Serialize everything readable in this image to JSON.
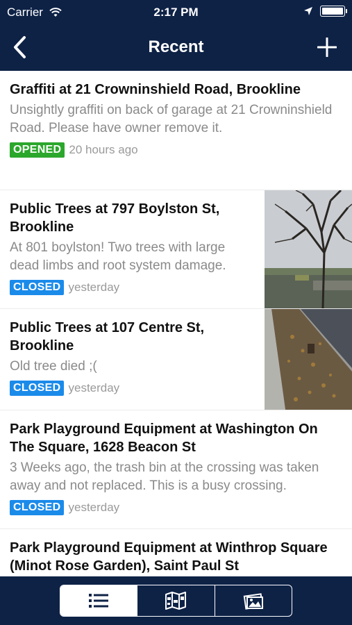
{
  "status_bar": {
    "carrier": "Carrier",
    "time": "2:17 PM"
  },
  "nav": {
    "title": "Recent",
    "back_icon": "chevron-left-icon",
    "add_icon": "plus-icon"
  },
  "items": [
    {
      "title": "Graffiti at 21 Crowninshield Road, Brookline",
      "description": "Unsightly graffiti on back of garage at 21 Crowninshield Road. Please have owner remove it.",
      "status": "OPENED",
      "time": "20 hours ago",
      "has_thumbnail": false
    },
    {
      "title": "Public Trees at 797 Boylston St, Brookline",
      "description": "At 801 boylston! Two trees with large dead limbs and root system damage.",
      "status": "CLOSED",
      "time": "yesterday",
      "has_thumbnail": true
    },
    {
      "title": "Public Trees at 107 Centre St, Brookline",
      "description": "Old tree died ;(",
      "status": "CLOSED",
      "time": "yesterday",
      "has_thumbnail": true
    },
    {
      "title": "Park Playground Equipment at Washington On The Square, 1628 Beacon St",
      "description": "3 Weeks ago, the trash bin at the crossing was taken away and not replaced. This is a busy crossing.",
      "status": "CLOSED",
      "time": "yesterday",
      "has_thumbnail": false
    },
    {
      "title": "Park Playground Equipment at Winthrop Square (Minot Rose Garden), Saint Paul St",
      "description": "",
      "status": "",
      "time": "",
      "has_thumbnail": false
    }
  ],
  "tabs": [
    {
      "icon": "list-icon",
      "active": true
    },
    {
      "icon": "map-icon",
      "active": false
    },
    {
      "icon": "photo-gallery-icon",
      "active": false
    }
  ],
  "colors": {
    "navy": "#0e2246",
    "opened": "#2ba72b",
    "closed": "#1b8bea"
  }
}
